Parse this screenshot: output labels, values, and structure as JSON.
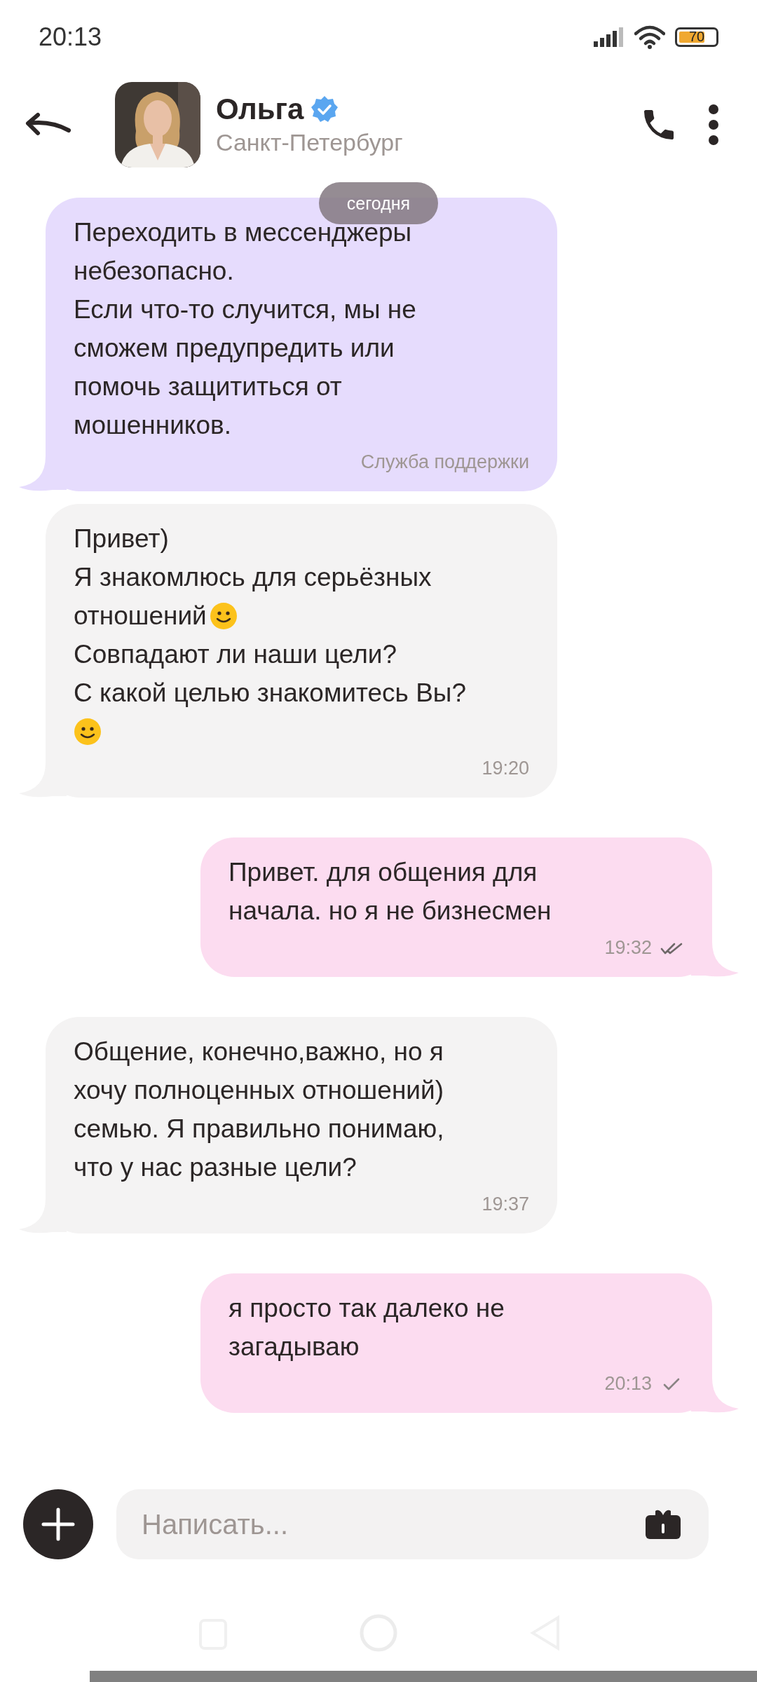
{
  "status_bar": {
    "time": "20:13",
    "battery": "70"
  },
  "header": {
    "name": "Ольга",
    "verified": true,
    "subtitle": "Санкт-Петербург"
  },
  "date_chip": "сегодня",
  "messages": [
    {
      "outgoing": false,
      "kind": "system",
      "lines": [
        {
          "text": "Переходить в мессенджеры"
        },
        {
          "text": "небезопасно."
        },
        {
          "text": "Если что-то случится, мы не"
        },
        {
          "text": "сможем предупредить или"
        },
        {
          "text": "помочь защититься от"
        },
        {
          "text": "мошенников."
        }
      ],
      "meta": "Служба поддержки"
    },
    {
      "outgoing": false,
      "kind": "user",
      "lines": [
        {
          "text": "Привет)"
        },
        {
          "text": "Я знакомлюсь для серьёзных"
        },
        {
          "text": "отношений",
          "smiley": true
        },
        {
          "text": "Совпадают ли наши цели?"
        },
        {
          "text": "С какой целью знакомитесь Вы?"
        },
        {
          "smiley": true
        }
      ],
      "meta": "19:20"
    },
    {
      "outgoing": true,
      "kind": "user",
      "lines": [
        {
          "text": "Привет. для общения для"
        },
        {
          "text": "начала. но я не бизнесмен"
        }
      ],
      "meta": "19:32",
      "read": true
    },
    {
      "outgoing": false,
      "kind": "user",
      "lines": [
        {
          "text": "Общение, конечно,важно, но я"
        },
        {
          "text": "хочу полноценных отношений)"
        },
        {
          "text": "семью. Я правильно понимаю,"
        },
        {
          "text": "что у нас разные цели?"
        }
      ],
      "meta": "19:37"
    },
    {
      "outgoing": true,
      "kind": "user",
      "lines": [
        {
          "text": "я просто так далеко не"
        },
        {
          "text": "загадываю"
        }
      ],
      "meta": "20:13",
      "read": false
    }
  ],
  "composer": {
    "placeholder": "Написать..."
  }
}
